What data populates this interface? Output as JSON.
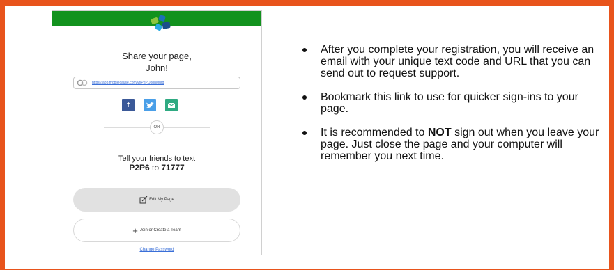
{
  "mockup": {
    "share_title_line1": "Share your page,",
    "share_title_line2": "John!",
    "url": "https://app.mobilecause.com/vf/P2P/JohnMurd",
    "social": [
      "f",
      "t",
      "✉"
    ],
    "or_label": "OR",
    "tell_text": "Tell your friends to text",
    "code": "P2P6",
    "to_word": "to",
    "number": "71777",
    "edit_label": "Edit My Page",
    "join_label": "Join or Create a Team",
    "change_password": "Change Password",
    "colors": {
      "header": "#12921e",
      "facebook": "#3b5998",
      "twitter": "#4a9fe8",
      "email": "#2faa82"
    }
  },
  "bullets": [
    {
      "text": "After you complete your registration, you will receive an email with your unique text code and URL that you can send out to request support."
    },
    {
      "text": "Bookmark this link to use for quicker sign-ins to your page."
    },
    {
      "pre": "It is recommended to ",
      "bold": "NOT",
      "post": " sign out when you leave your page. Just close the page and your computer will remember you next time."
    }
  ],
  "frame_color": "#e8541c"
}
